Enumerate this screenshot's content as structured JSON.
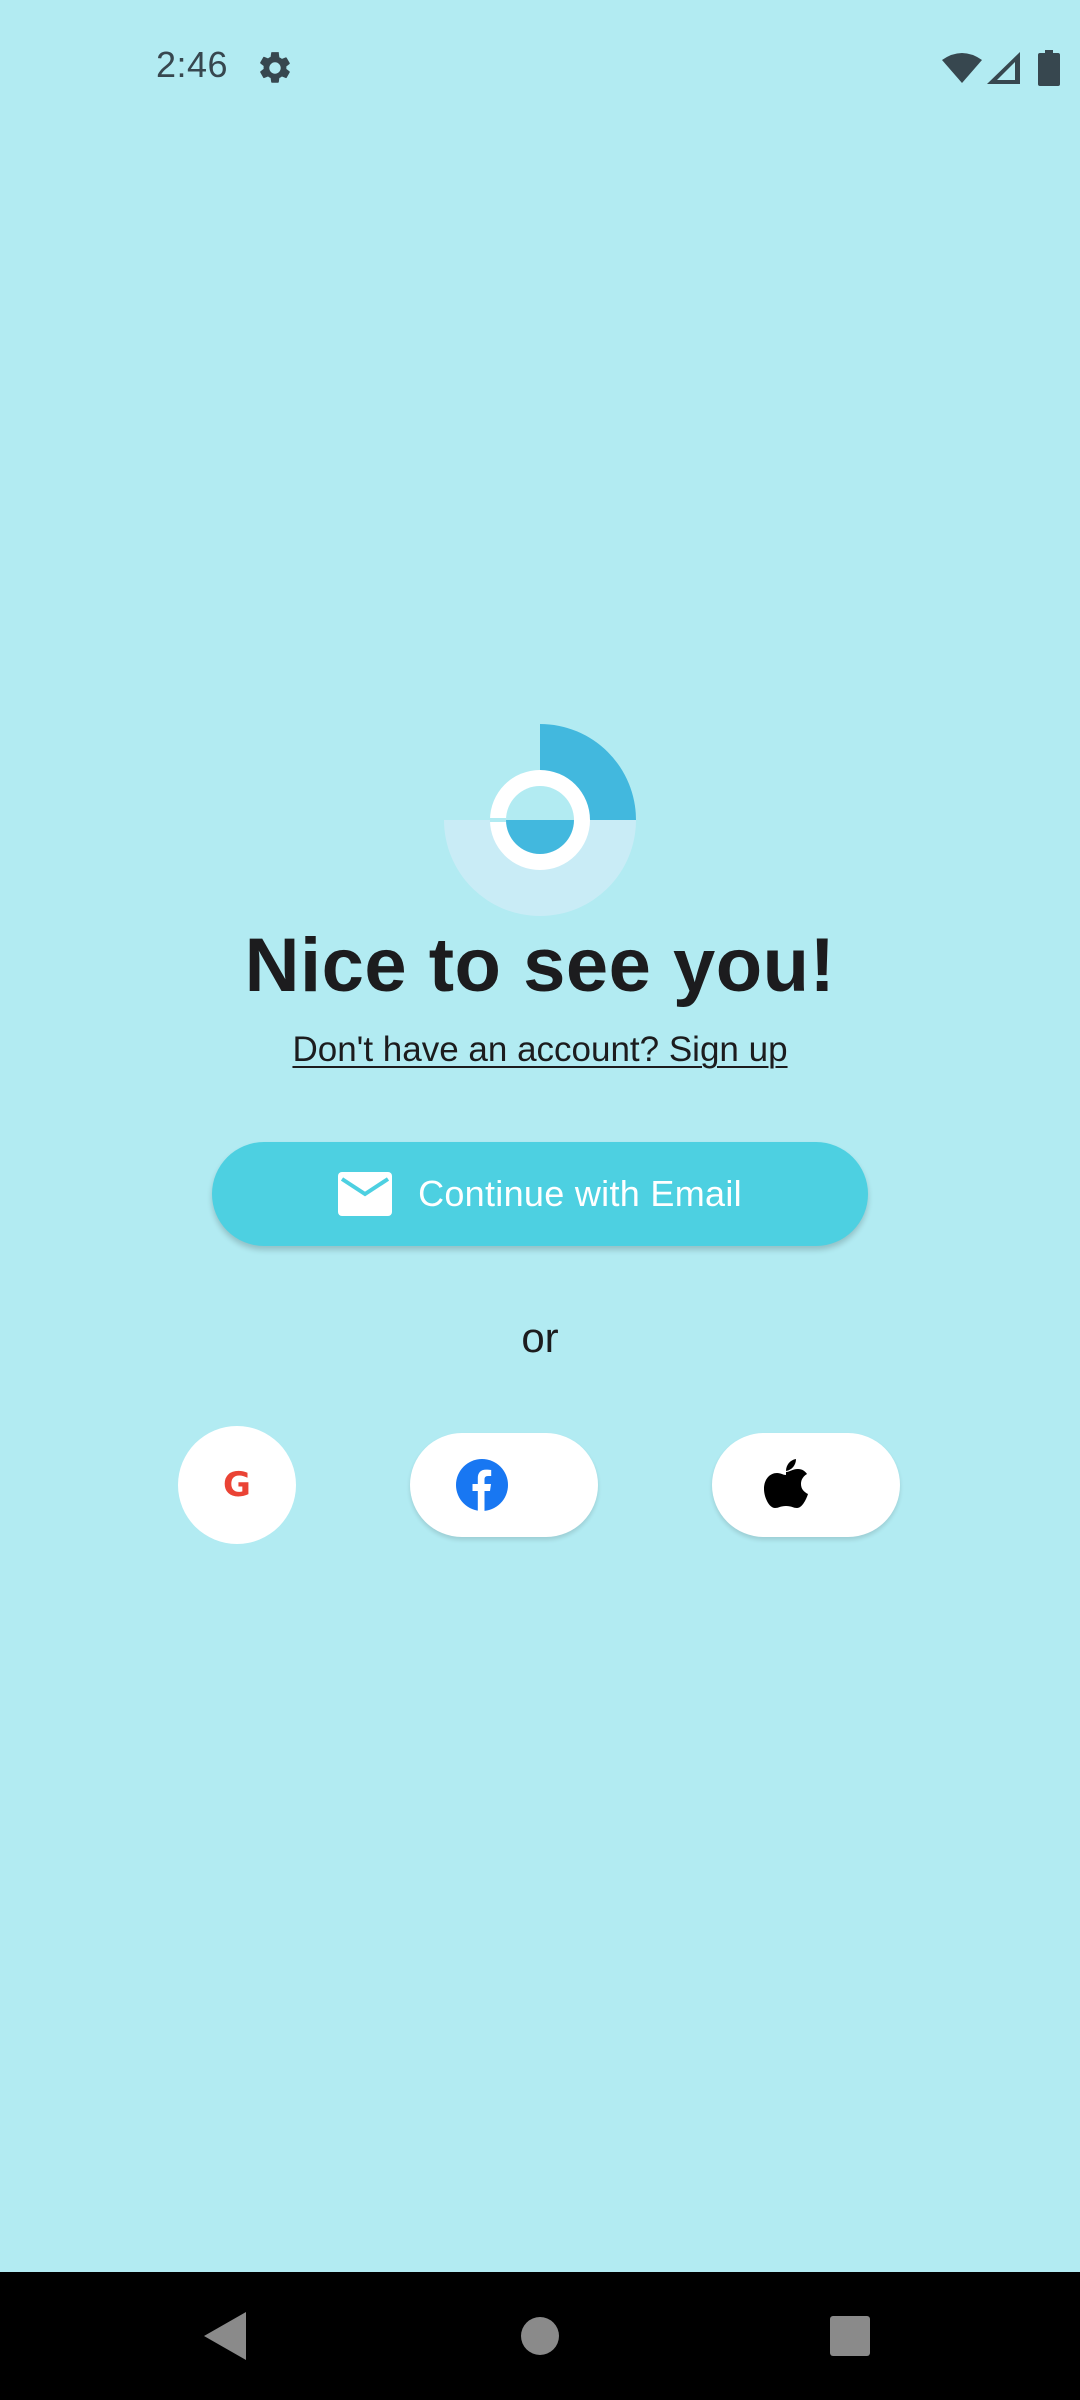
{
  "status_bar": {
    "time": "2:46",
    "icons": [
      "gear-icon",
      "wifi-icon",
      "cell-signal-icon",
      "battery-icon"
    ]
  },
  "logo": {
    "icon": "app-logo-icon",
    "colors": {
      "dark": "#42b8de",
      "light": "#c9ecf6",
      "ring": "#ffffff"
    }
  },
  "headline": "Nice to see you!",
  "signup_link": "Don't have an account? Sign up",
  "email_button": {
    "label": "Continue with Email",
    "icon": "mail-icon",
    "color": "#4dd0e1"
  },
  "separator": "or",
  "social": [
    {
      "name": "google",
      "icon": "google-icon",
      "glyph": "G",
      "color": "#ea4335"
    },
    {
      "name": "facebook",
      "icon": "facebook-icon",
      "color": "#1877f2"
    },
    {
      "name": "apple",
      "icon": "apple-icon",
      "color": "#000000"
    }
  ],
  "nav_bar": {
    "icons": [
      "back-icon",
      "home-icon",
      "recents-icon"
    ]
  },
  "colors": {
    "background": "#b2ebf2",
    "text": "#1c1c1e",
    "status_icons": "#37474f"
  }
}
